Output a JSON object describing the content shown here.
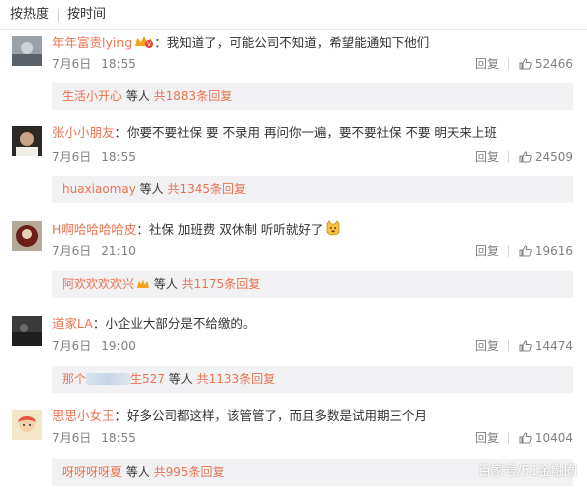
{
  "sort_bar": {
    "by_hot": "按热度",
    "by_time": "按时间"
  },
  "comments": [
    {
      "username": "年年富贵lying",
      "text": "我知道了，可能公司不知道，希望能通知下他们",
      "date": "7月6日",
      "time": "18:55",
      "reply_label": "回复",
      "likes": "52466",
      "thread": {
        "user": "生活小开心",
        "mid": " 等人 ",
        "total": "共1883条回复"
      }
    },
    {
      "username": "张小小朋友",
      "text": "你要不要社保 要 不录用 再问你一遍，要不要社保 不要 明天来上班",
      "date": "7月6日",
      "time": "18:55",
      "reply_label": "回复",
      "likes": "24509",
      "thread": {
        "user": "huaxiaomay",
        "mid": " 等人 ",
        "total": "共1345条回复"
      }
    },
    {
      "username": "H啊哈哈哈哈皮",
      "text": "社保 加班费 双休制  听听就好了",
      "date": "7月6日",
      "time": "21:10",
      "reply_label": "回复",
      "likes": "19616",
      "thread": {
        "user": "阿欢欢欢欢兴",
        "mid": " 等人 ",
        "total": "共1175条回复"
      }
    },
    {
      "username": "道家LA",
      "text": "小企业大部分是不给缴的。",
      "date": "7月6日",
      "time": "19:00",
      "reply_label": "回复",
      "likes": "14474",
      "thread": {
        "user": "那个",
        "user_tail": "生527",
        "mid": " 等人 ",
        "total": "共1133条回复"
      }
    },
    {
      "username": "思思小女王",
      "text": "好多公司都这样，该管管了，而且多数是试用期三个月",
      "date": "7月6日",
      "time": "18:55",
      "reply_label": "回复",
      "likes": "10404",
      "thread": {
        "user": "呀呀呀呀夏",
        "mid": " 等人 ",
        "total": "共995条回复"
      }
    }
  ],
  "watermark": "百家号/51金融圈",
  "colors": {
    "username": "#eb7350",
    "meta": "#808080",
    "reply_box": "#f2f2f5"
  },
  "icons": {
    "like": "thumb-up-icon",
    "badge": "vip-crown-icon",
    "emoji": "dog-face-emoji"
  }
}
